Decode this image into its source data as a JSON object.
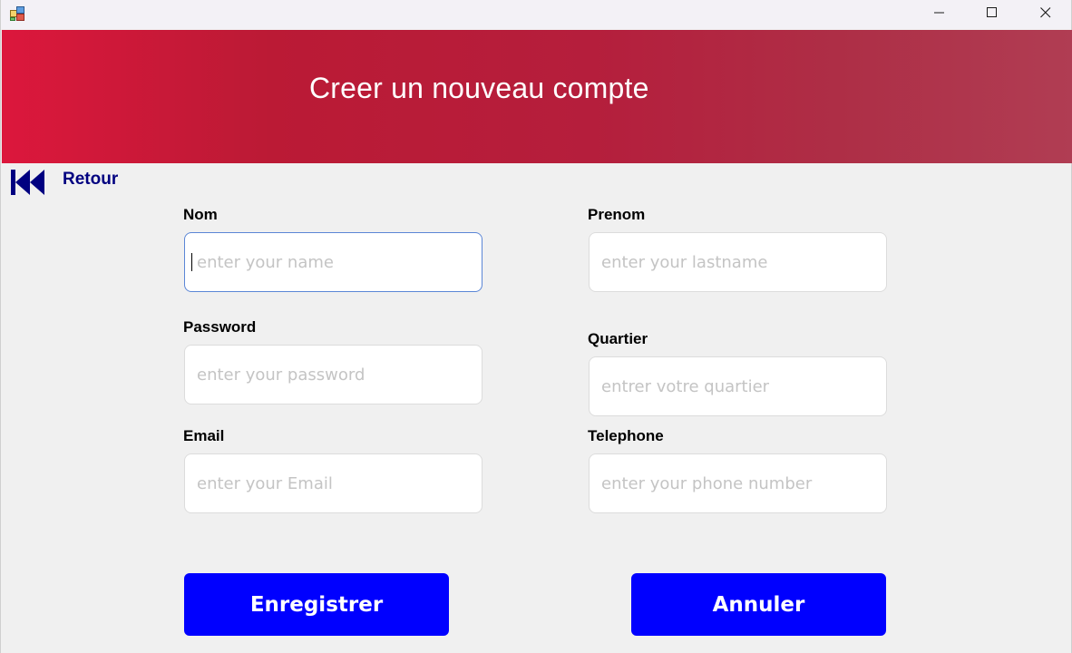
{
  "window": {
    "controls": {
      "minimize_icon": "minimize-icon",
      "maximize_icon": "maximize-icon",
      "close_icon": "close-icon"
    }
  },
  "header": {
    "title": "Creer un nouveau compte",
    "gradient_colors": [
      "#dc173c",
      "#b51e3c",
      "#b03d53"
    ]
  },
  "back": {
    "icon": "skip-back-icon",
    "label": "Retour",
    "color": "#000080"
  },
  "form": {
    "nom": {
      "label": "Nom",
      "placeholder": "enter your name",
      "value": ""
    },
    "prenom": {
      "label": "Prenom",
      "placeholder": "enter your lastname",
      "value": ""
    },
    "password": {
      "label": "Password",
      "placeholder": "enter your password",
      "value": ""
    },
    "quartier": {
      "label": "Quartier",
      "placeholder": "entrer votre quartier",
      "value": ""
    },
    "email": {
      "label": "Email",
      "placeholder": "enter your Email",
      "value": ""
    },
    "telephone": {
      "label": "Telephone",
      "placeholder": "enter your phone number",
      "value": ""
    }
  },
  "actions": {
    "save_label": "Enregistrer",
    "cancel_label": "Annuler",
    "button_color": "#0000ff"
  }
}
